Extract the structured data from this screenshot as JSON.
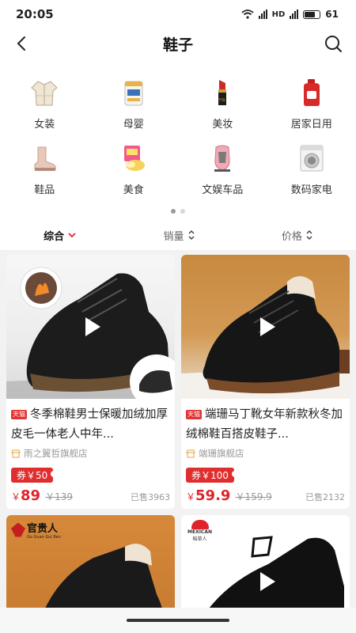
{
  "status": {
    "time": "20:05",
    "battery": "61"
  },
  "nav": {
    "title": "鞋子"
  },
  "categories": [
    {
      "label": "女装",
      "icon": "coat-icon"
    },
    {
      "label": "母婴",
      "icon": "formula-can-icon"
    },
    {
      "label": "美妆",
      "icon": "lipstick-icon"
    },
    {
      "label": "居家日用",
      "icon": "detergent-bottle-icon"
    },
    {
      "label": "鞋品",
      "icon": "boot-icon"
    },
    {
      "label": "美食",
      "icon": "snack-icon"
    },
    {
      "label": "文娱车品",
      "icon": "car-seat-icon"
    },
    {
      "label": "数码家电",
      "icon": "washing-machine-icon"
    }
  ],
  "sort": {
    "comprehensive": "综合",
    "sales": "销量",
    "price": "价格"
  },
  "products": [
    {
      "tag": "天猫",
      "title": "冬季棉鞋男士保暖加绒加厚皮毛一体老人中年...",
      "shop": "雨之翼哲旗舰店",
      "coupon": "券￥50",
      "currency": "￥",
      "price": "89",
      "original": "￥139",
      "sold": "已售3963"
    },
    {
      "tag": "天猫",
      "title": "端珊马丁靴女年新款秋冬加绒棉鞋百搭皮鞋子...",
      "shop": "端珊旗舰店",
      "coupon": "券￥100",
      "currency": "￥",
      "price": "59.9",
      "original": "￥159.9",
      "sold": "已售2132"
    }
  ],
  "brands": {
    "card3_logo": "官贵人",
    "card3_logo_sub": "Go Guan Gui Ren",
    "card4_logo_en": "MEXICAN",
    "card4_logo_cn": "稻草人"
  },
  "colors": {
    "accent": "#e0232b"
  }
}
